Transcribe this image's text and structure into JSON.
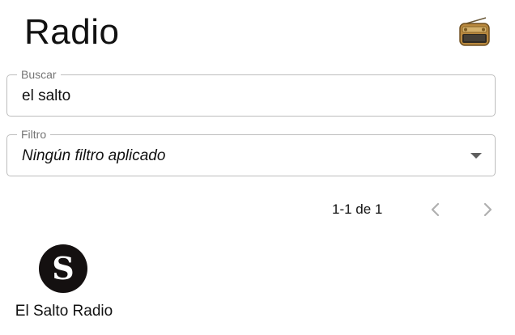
{
  "header": {
    "title": "Radio",
    "icon": "radio-icon"
  },
  "search": {
    "label": "Buscar",
    "value": "el salto",
    "icon": "none"
  },
  "filter": {
    "label": "Filtro",
    "selected": "Ningún filtro aplicado",
    "icon": "chevron-down-icon"
  },
  "pagination": {
    "range": "1-1 de 1",
    "prev_icon": "chevron-left-icon",
    "next_icon": "chevron-right-icon"
  },
  "stations": [
    {
      "name": "El Salto Radio",
      "logo_letter": "S",
      "logo_color": "#141010"
    }
  ],
  "colors": {
    "border": "#bdbdbd",
    "label": "#757575",
    "nav_icon": "#b0b0b0",
    "radio_body": "#a67c3d"
  }
}
